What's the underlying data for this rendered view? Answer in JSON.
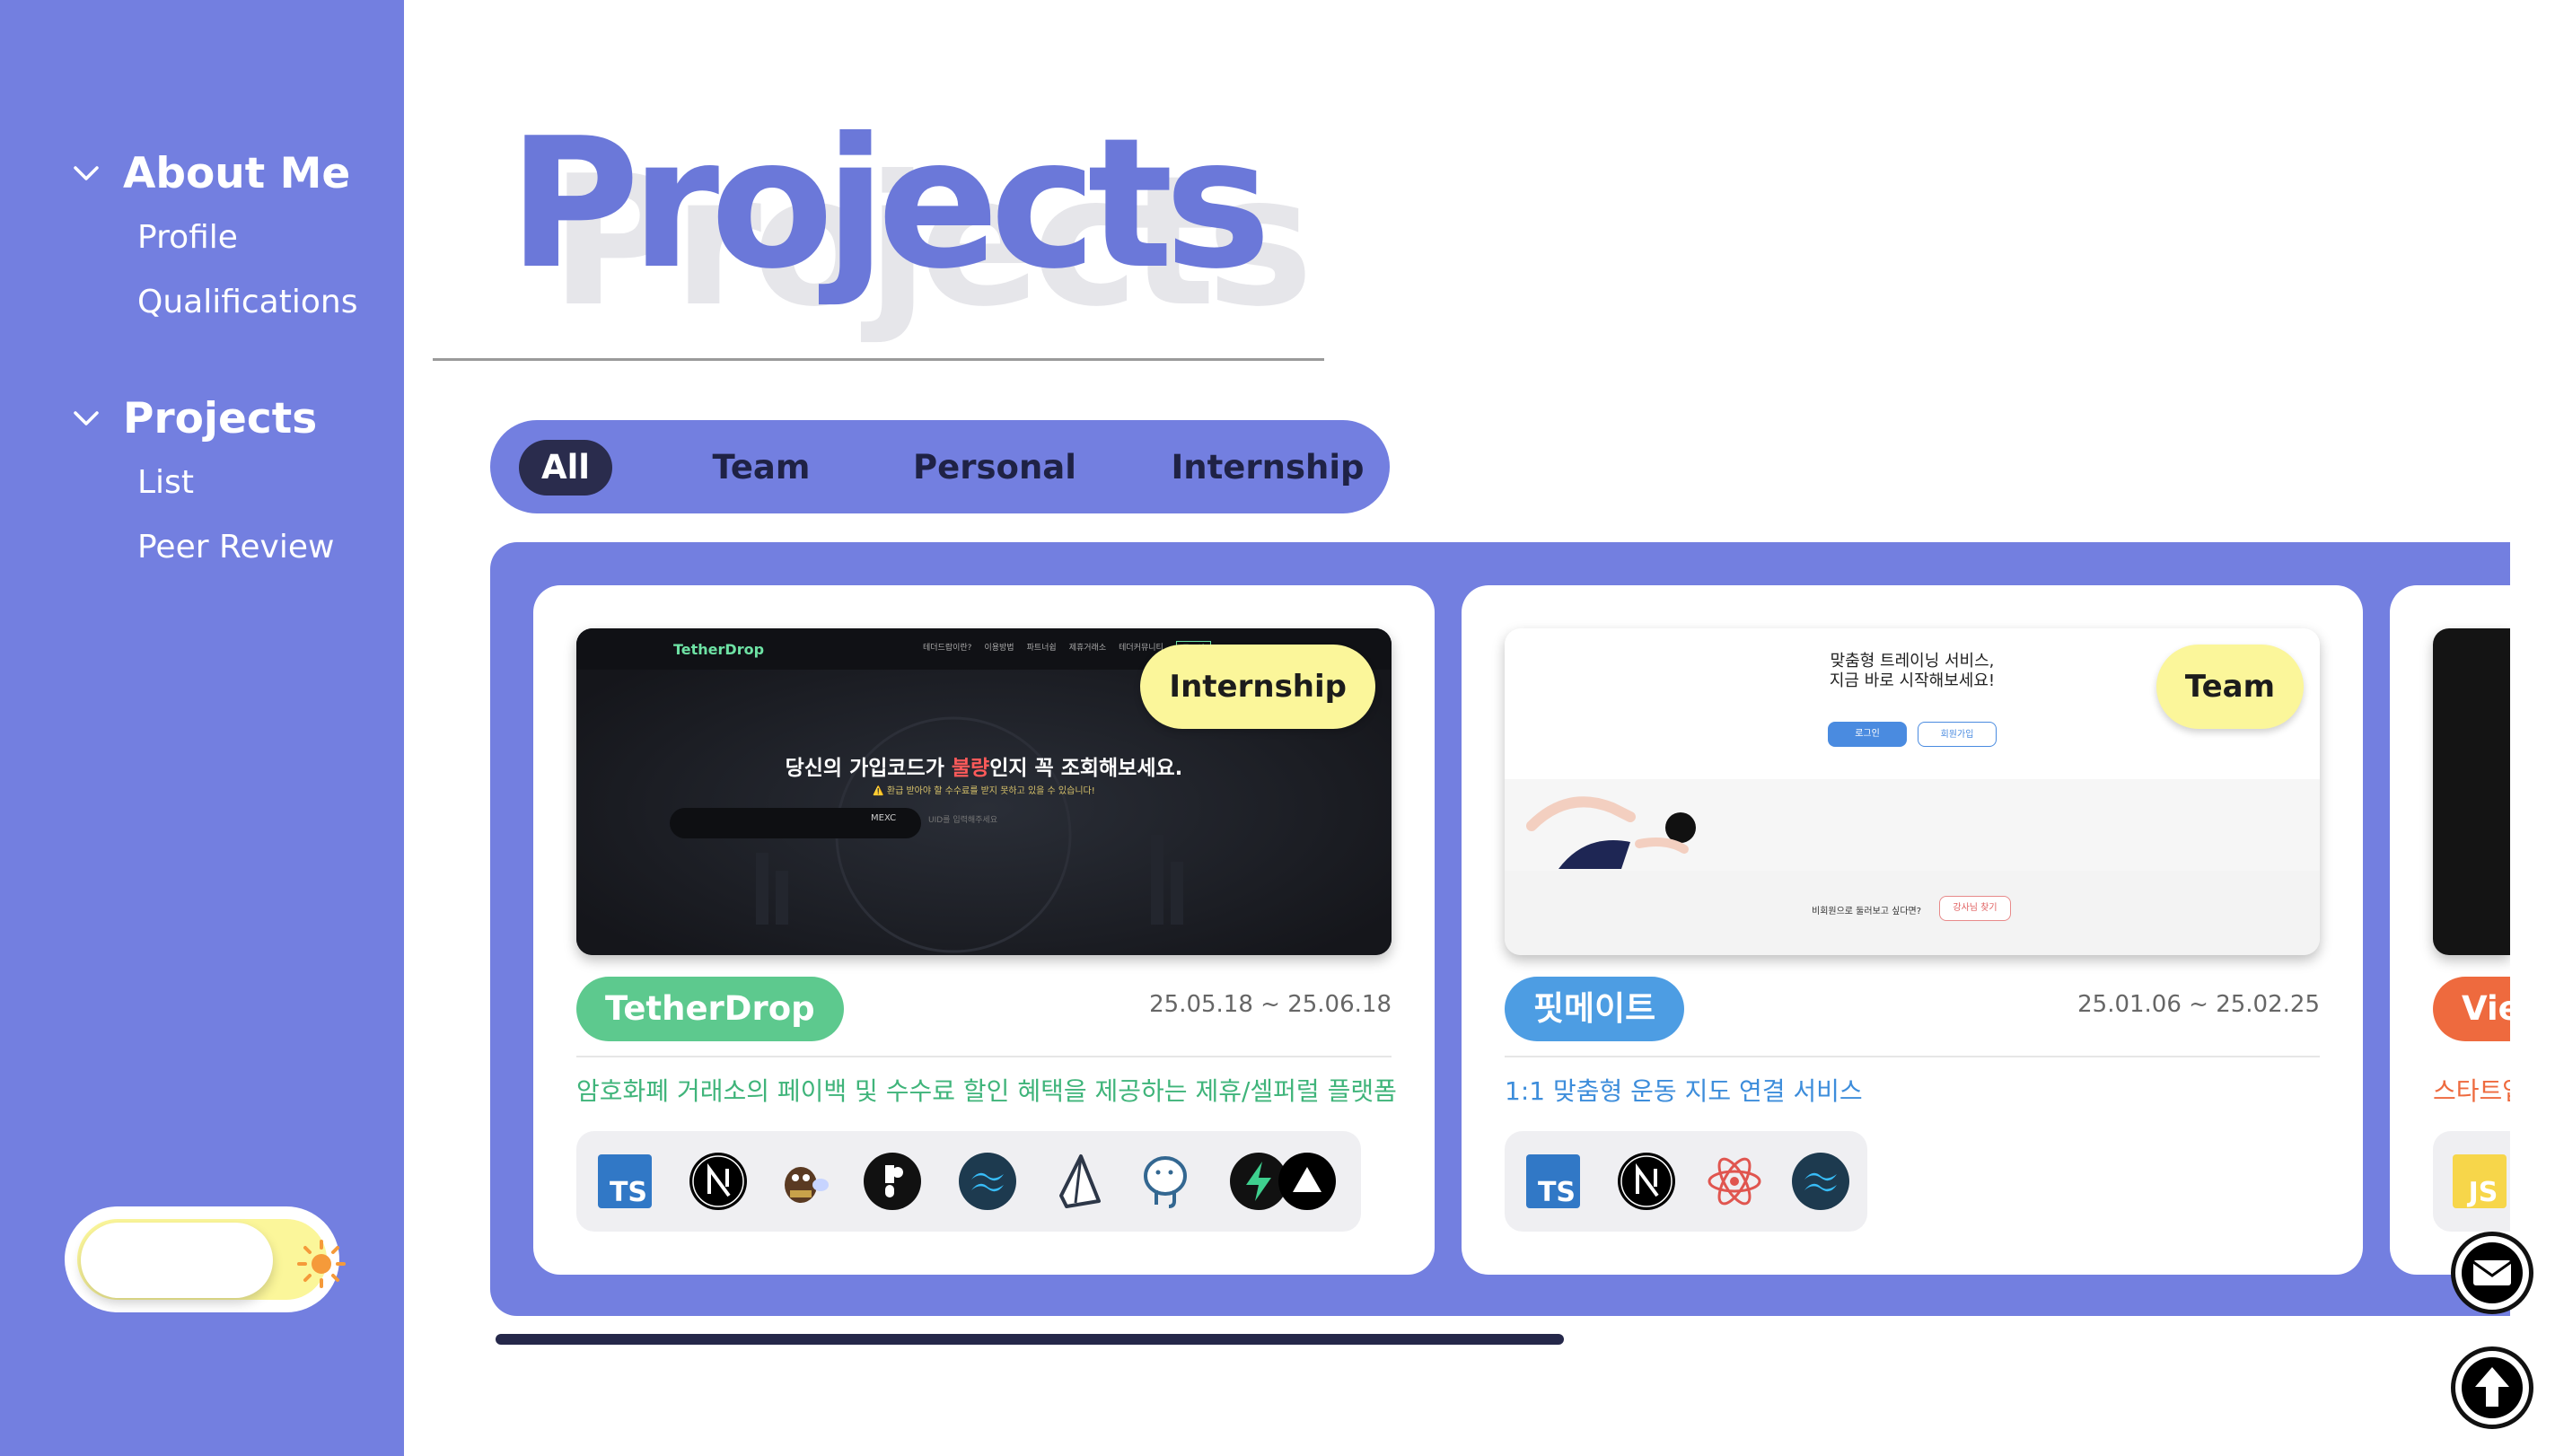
{
  "sidebar": {
    "sections": [
      {
        "label": "About Me",
        "items": [
          {
            "label": "Profile"
          },
          {
            "label": "Qualifications"
          }
        ]
      },
      {
        "label": "Projects",
        "items": [
          {
            "label": "List"
          },
          {
            "label": "Peer Review"
          }
        ]
      }
    ],
    "theme_toggle": {
      "mode": "light",
      "icon": "sun-icon"
    }
  },
  "page": {
    "title": "Projects",
    "filters": [
      {
        "label": "All",
        "active": true
      },
      {
        "label": "Team",
        "active": false
      },
      {
        "label": "Personal",
        "active": false
      },
      {
        "label": "Internship",
        "active": false
      }
    ]
  },
  "projects": [
    {
      "badge": "Internship",
      "name": "TetherDrop",
      "name_color": "#5dc98e",
      "period": "25.05.18 ~ 25.06.18",
      "description": "암호화폐 거래소의 페이백 및 수수료 할인 혜택을 제공하는 제휴/셀퍼럴 플랫폼",
      "description_color": "#3fb47a",
      "stack": [
        "typescript-icon",
        "nextjs-icon",
        "zustand-icon",
        "radix-icon",
        "tailwind-icon",
        "prisma-icon",
        "postgresql-icon",
        "supabase-icon",
        "vercel-icon"
      ],
      "screenshot": {
        "logo": "TetherDrop",
        "headline_prefix": "당신의 가입코드가 ",
        "headline_highlight": "불량",
        "headline_suffix": "인지 꼭 조회해보세요.",
        "subline": "⚠️ 환급 받아야 할 수수료를 받지 못하고 있을 수 있습니다!",
        "exchange": "MEXC",
        "search_placeholder": "UID를 입력해주세요",
        "menu": [
          "테더드랍이란?",
          "이용방법",
          "파트너쉽",
          "제휴거래소",
          "테더커뮤니티",
          "로그인"
        ]
      }
    },
    {
      "badge": "Team",
      "name": "핏메이트",
      "name_color": "#4d9de3",
      "period": "25.01.06 ~ 25.02.25",
      "description": "1:1 맞춤형 운동 지도 연결 서비스",
      "description_color": "#3d8ddb",
      "stack": [
        "typescript-icon",
        "nextjs-icon",
        "react-icon",
        "tailwind-icon"
      ],
      "screenshot": {
        "headline_line1": "맞춤형 트레이닝 서비스,",
        "headline_line2": "지금 바로 시작해보세요!",
        "login_label": "로그인",
        "signup_label": "회원가입",
        "bottom_text": "비회원으로 둘러보고 싶다면?",
        "bottom_button": "강사님 찾기"
      }
    },
    {
      "name": "Vie",
      "name_color": "#ee6a3e",
      "description": "스타트업",
      "description_color": "#ee6a3e",
      "stack": [
        "javascript-icon"
      ]
    }
  ],
  "floating": {
    "mail": "mail-icon",
    "top": "arrow-up-icon"
  }
}
